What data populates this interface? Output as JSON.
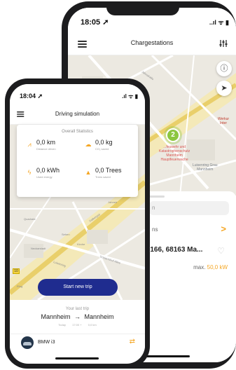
{
  "back_phone": {
    "status": {
      "time": "18:05 ➚",
      "indicators": "..ıl ᯤ ▮"
    },
    "header": {
      "title": "Chargestations"
    },
    "map": {
      "cluster_count": "2",
      "poi_red": [
        "...feuwehr und",
        "Katastrophenschutz",
        "Mannheim",
        "Hauptfeuerwache"
      ],
      "poi_gray": [
        "Luisenring Grau",
        "Mannheim"
      ],
      "right_label": [
        "Werkur",
        "Inter"
      ],
      "street_label": "Jahnstraße"
    },
    "panel": {
      "search_text": "n",
      "nearby_text": "ns",
      "address": "-166, 68163 Ma...",
      "max_label": "max.",
      "max_value": "50,0 kW"
    }
  },
  "front_phone": {
    "status": {
      "time": "18:04 ➚",
      "indicators": ".ıl ᯤ ▮"
    },
    "header": {
      "title": "Driving simulation"
    },
    "stats": {
      "title": "Overall Statistics",
      "items": [
        {
          "icon": "road-icon",
          "value": "0,0 km",
          "label": "Distance driven"
        },
        {
          "icon": "cloud-icon",
          "value": "0,0 kg",
          "label": "CO₂ saved"
        },
        {
          "icon": "bolt-icon",
          "value": "0,0 kWh",
          "label": "Used energy"
        },
        {
          "icon": "tree-icon",
          "value": "0,0 Trees",
          "label": "Trees saved"
        }
      ]
    },
    "map_labels": [
      "Jahnstr",
      "Neckarstadt",
      "Sehen",
      "Dalbergstr",
      "Kirche",
      "Quadrate",
      "Schlachthof Allee",
      "Luisenring",
      "Ring"
    ],
    "map_marker": "10",
    "start_button": "Start new trip",
    "last_trip": {
      "label": "Your last trip",
      "from": "Mannheim",
      "arrow": "→",
      "to": "Mannheim",
      "meta": [
        "Today",
        "17:00 +",
        "0,0 km"
      ]
    },
    "car": {
      "name": "BMW i3"
    }
  }
}
